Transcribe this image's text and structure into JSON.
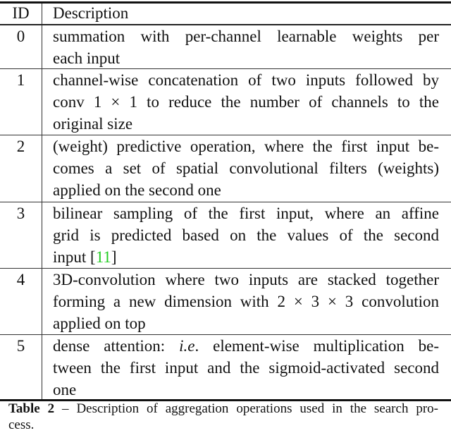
{
  "table": {
    "headers": {
      "id": "ID",
      "description": "Description"
    },
    "rows": [
      {
        "id": "0",
        "lines": [
          "summation with per-channel learnable weights per",
          "each input"
        ]
      },
      {
        "id": "1",
        "lines": [
          "channel-wise concatenation of two inputs followed by",
          "conv 1 × 1 to reduce the number of channels to the",
          "original size"
        ]
      },
      {
        "id": "2",
        "lines": [
          "(weight) predictive operation, where the first input be-",
          "comes a set of spatial convolutional filters (weights)",
          "applied on the second one"
        ]
      },
      {
        "id": "3",
        "lines": [
          "bilinear sampling of the first input, where an affine",
          "grid is predicted based on the values of the second"
        ],
        "last_prefix": "input [",
        "citation": "11",
        "last_suffix": "]"
      },
      {
        "id": "4",
        "lines": [
          "3D-convolution where two inputs are stacked together",
          "forming a new dimension with 2 × 3 × 3 convolution",
          "applied on top"
        ]
      },
      {
        "id": "5",
        "line1_prefix": "dense attention: ",
        "line1_italic": "i.e",
        "line1_suffix": ". element-wise multiplication be-",
        "lines": [
          "tween the first input and the sigmoid-activated second",
          "one"
        ]
      }
    ]
  },
  "caption": {
    "label": "Table 2",
    "dash": " – ",
    "line1": "Description of aggregation operations used in the search pro-",
    "line2": "cess."
  },
  "colors": {
    "citation": "#22cc22"
  }
}
